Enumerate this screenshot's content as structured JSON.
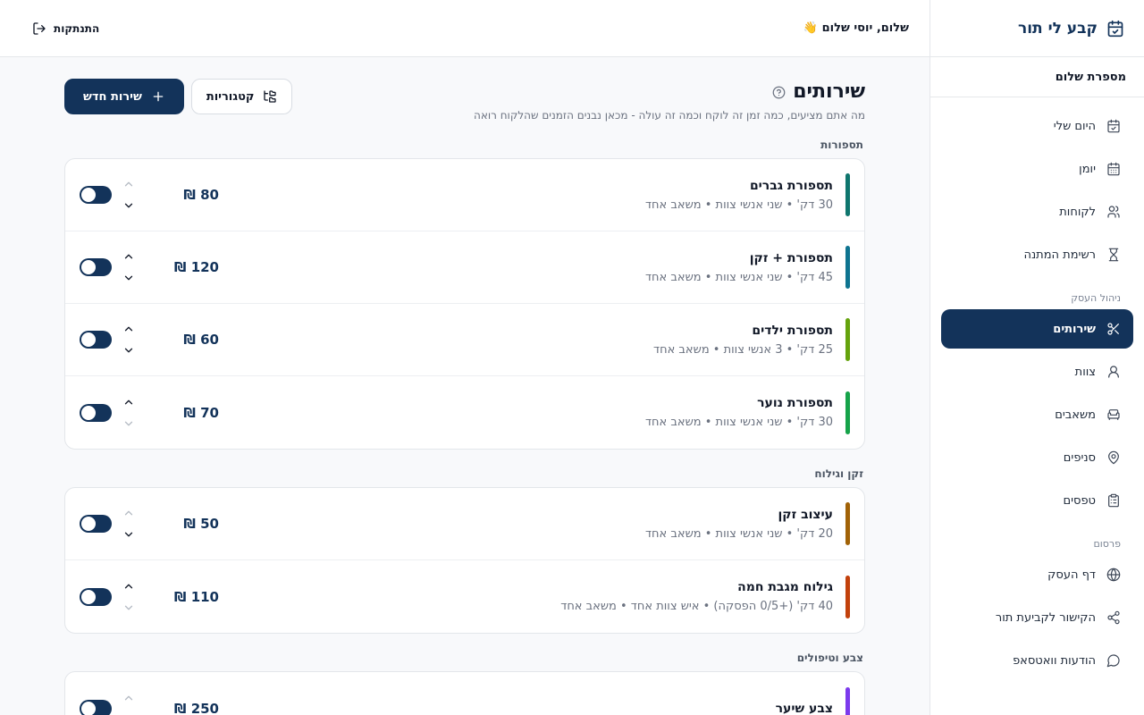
{
  "brand": {
    "name": "קבע לי תור"
  },
  "business": {
    "name": "מספרת שלום"
  },
  "sidebar": {
    "items": [
      {
        "label": "היום שלי",
        "icon": "calendar-check-icon"
      },
      {
        "label": "יומן",
        "icon": "calendar-icon"
      },
      {
        "label": "לקוחות",
        "icon": "users-icon"
      },
      {
        "label": "רשימת המתנה",
        "icon": "hourglass-icon"
      }
    ],
    "section_business": "ניהול העסק",
    "business_items": [
      {
        "label": "שירותים",
        "icon": "scissors-icon",
        "active": true
      },
      {
        "label": "צוות",
        "icon": "user-icon"
      },
      {
        "label": "משאבים",
        "icon": "armchair-icon"
      },
      {
        "label": "סניפים",
        "icon": "map-pin-icon"
      },
      {
        "label": "טפסים",
        "icon": "clipboard-icon"
      }
    ],
    "section_publish": "פרסום",
    "publish_items": [
      {
        "label": "דף העסק",
        "icon": "globe-icon"
      },
      {
        "label": "הקישור לקביעת תור",
        "icon": "share-icon"
      },
      {
        "label": "הודעות וואטסאפ",
        "icon": "message-circle-icon"
      }
    ]
  },
  "header": {
    "greeting": "שלום, יוסי שלום 👋",
    "logout": "התנתקות"
  },
  "page": {
    "title": "שירותים",
    "subtitle": "מה אתם מציעים, כמה זמן זה לוקח וכמה זה עולה - מכאן נבנים הזמנים שהלקוח רואה",
    "categories_button": "קטגוריות",
    "new_service_button": "שירות חדש"
  },
  "categories": [
    {
      "label": "תספורות",
      "services": [
        {
          "name": "תספורת גברים",
          "meta": "30 דק' • שני אנשי צוות • משאב אחד",
          "price": "80 ₪",
          "color": "#0f766e",
          "enabled": true,
          "up_disabled": true,
          "down_disabled": false
        },
        {
          "name": "תספורת + זקן",
          "meta": "45 דק' • שני אנשי צוות • משאב אחד",
          "price": "120 ₪",
          "color": "#0e7490",
          "enabled": true,
          "up_disabled": false,
          "down_disabled": false
        },
        {
          "name": "תספורת ילדים",
          "meta": "25 דק' • 3 אנשי צוות • משאב אחד",
          "price": "60 ₪",
          "color": "#65a30d",
          "enabled": true,
          "up_disabled": false,
          "down_disabled": false
        },
        {
          "name": "תספורת נוער",
          "meta": "30 דק' • שני אנשי צוות • משאב אחד",
          "price": "70 ₪",
          "color": "#16a34a",
          "enabled": true,
          "up_disabled": false,
          "down_disabled": true
        }
      ]
    },
    {
      "label": "זקן וגילוח",
      "services": [
        {
          "name": "עיצוב זקן",
          "meta": "20 דק' • שני אנשי צוות • משאב אחד",
          "price": "50 ₪",
          "color": "#a16207",
          "enabled": true,
          "up_disabled": true,
          "down_disabled": false
        },
        {
          "name": "גילוח מגבת חמה",
          "meta": "40 דק' (+0/5 הפסקה) • איש צוות אחד • משאב אחד",
          "price": "110 ₪",
          "color": "#c2410c",
          "enabled": true,
          "up_disabled": false,
          "down_disabled": true
        }
      ]
    },
    {
      "label": "צבע וטיפולים",
      "services": [
        {
          "name": "צבע שיער",
          "meta": "",
          "price": "250 ₪",
          "color": "#7c3aed",
          "enabled": true,
          "up_disabled": true,
          "down_disabled": false
        }
      ]
    }
  ]
}
